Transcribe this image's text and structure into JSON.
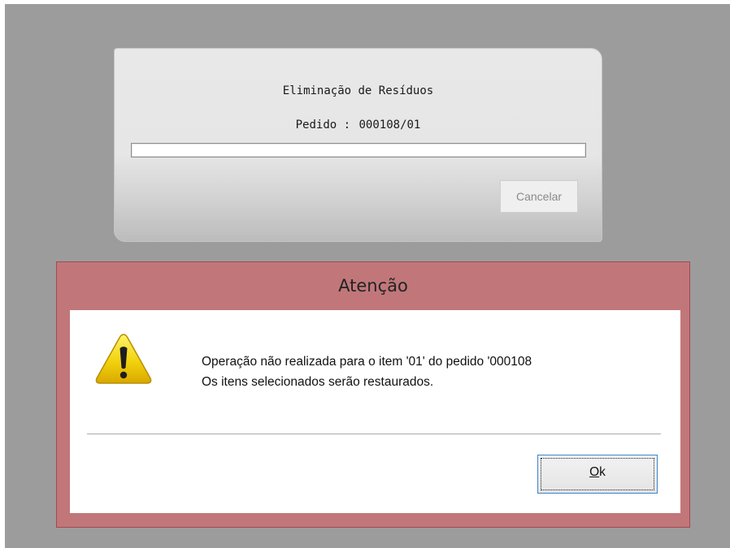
{
  "progress_dialog": {
    "title": "Eliminação de Resíduos",
    "order_label": "Pedido :",
    "order_number": "000108/01",
    "progress_fraction": 0,
    "cancel_label": "Cancelar"
  },
  "alert_dialog": {
    "title": "Atenção",
    "icon": "warning-icon",
    "message_lines": [
      "Operação não realizada para o item '01' do pedido '000108",
      "Os itens selecionados serão restaurados."
    ],
    "ok_mnemonic": "O",
    "ok_rest": "k"
  },
  "colors": {
    "backdrop": "#9c9c9c",
    "alert_frame": "#c1777a",
    "alert_border": "#a24a50",
    "warning_yellow": "#f3d20c",
    "focus_blue": "#3b86d0"
  }
}
